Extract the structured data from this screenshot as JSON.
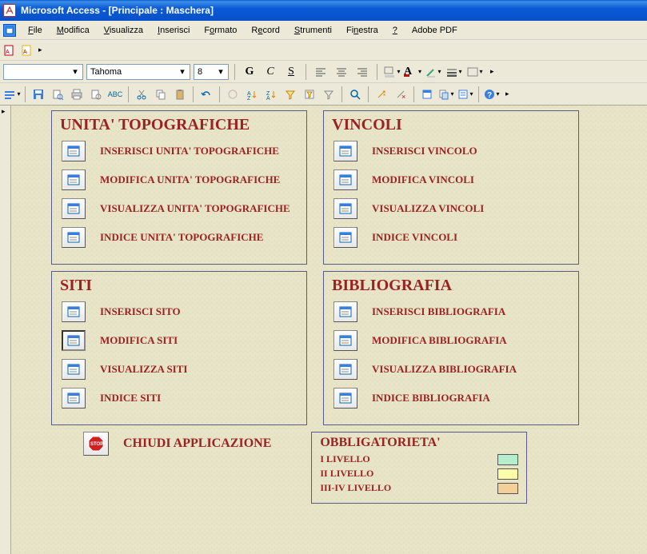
{
  "title": "Microsoft Access - [Principale : Maschera]",
  "menu": {
    "file": "File",
    "modifica": "Modifica",
    "visualizza": "Visualizza",
    "inserisci": "Inserisci",
    "formato": "Formato",
    "record": "Record",
    "strumenti": "Strumenti",
    "finestra": "Finestra",
    "help": "?",
    "adobe": "Adobe PDF"
  },
  "format_toolbar": {
    "object_combo": "",
    "font_combo": "Tahoma",
    "size_combo": "8"
  },
  "panels": {
    "ut": {
      "title": "UNITA' TOPOGRAFICHE",
      "r1": "INSERISCI UNITA' TOPOGRAFICHE",
      "r2": "MODIFICA UNITA' TOPOGRAFICHE",
      "r3": "VISUALIZZA UNITA' TOPOGRAFICHE",
      "r4": "INDICE UNITA' TOPOGRAFICHE"
    },
    "vincoli": {
      "title": "VINCOLI",
      "r1": "INSERISCI VINCOLO",
      "r2": "MODIFICA VINCOLI",
      "r3": "VISUALIZZA VINCOLI",
      "r4": "INDICE VINCOLI"
    },
    "siti": {
      "title": "SITI",
      "r1": "INSERISCI SITO",
      "r2": "MODIFICA SITI",
      "r3": "VISUALIZZA SITI",
      "r4": "INDICE SITI"
    },
    "biblio": {
      "title": "BIBLIOGRAFIA",
      "r1": "INSERISCI BIBLIOGRAFIA",
      "r2": "MODIFICA BIBLIOGRAFIA",
      "r3": "VISUALIZZA BIBLIOGRAFIA",
      "r4": "INDICE BIBLIOGRAFIA"
    }
  },
  "close_label": "CHIUDI APPLICAZIONE",
  "legend": {
    "title": "OBBLIGATORIETA'",
    "l1": "I LIVELLO",
    "l2": "II LIVELLO",
    "l3": "III-IV LIVELLO",
    "c1": "#b4eece",
    "c2": "#fdfca8",
    "c3": "#f5cf9a"
  }
}
